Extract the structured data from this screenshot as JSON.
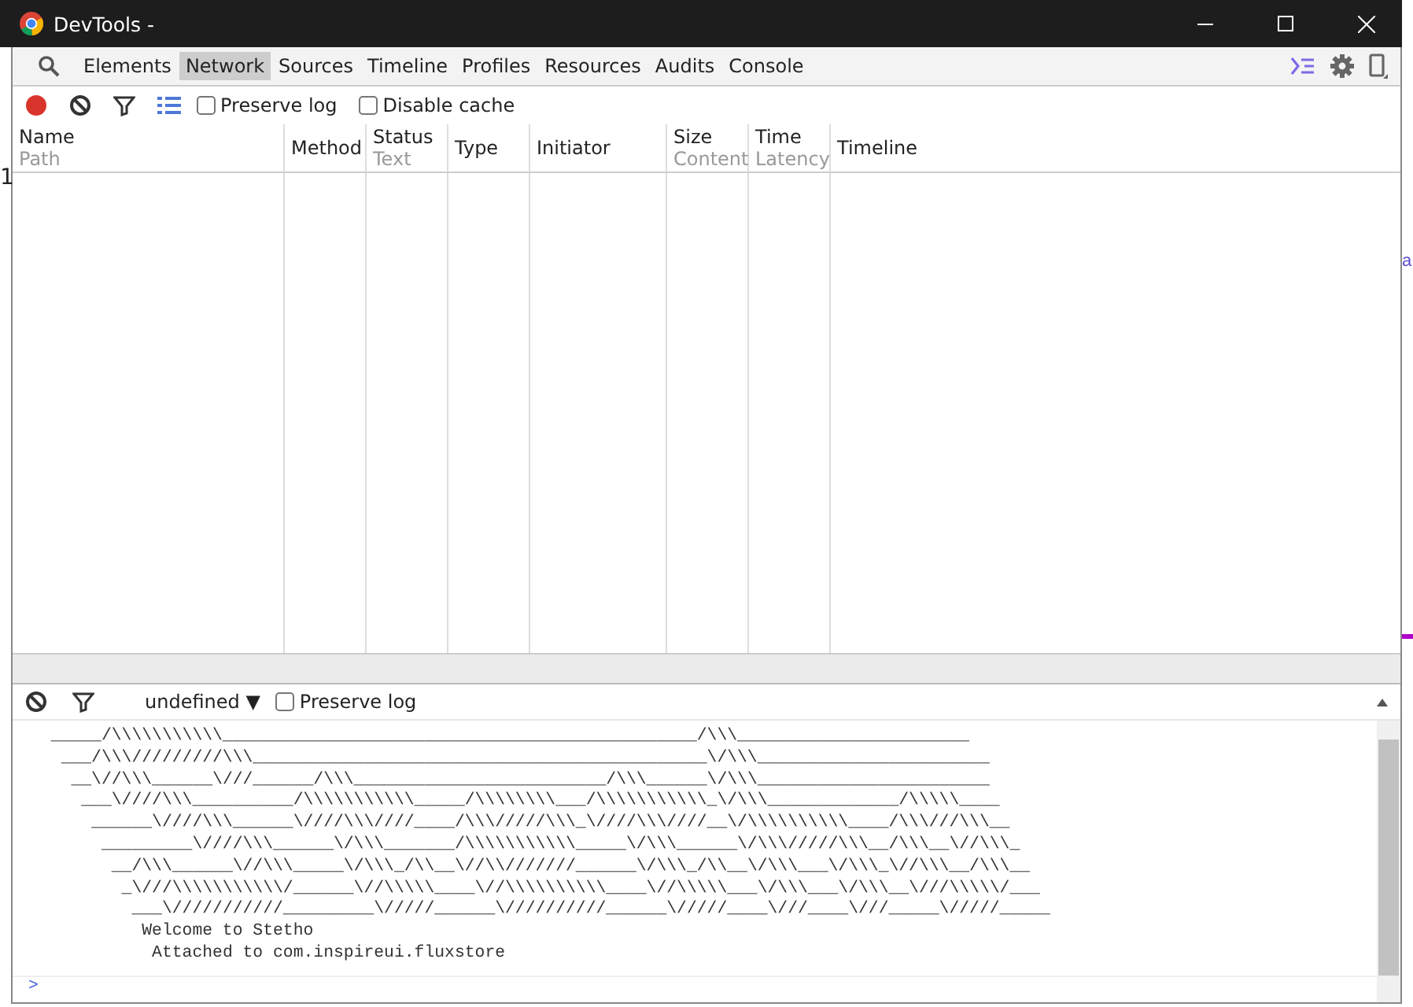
{
  "window": {
    "title": "DevTools -"
  },
  "background_text": [
    "1",
    "a"
  ],
  "tabs": [
    {
      "label": "Elements",
      "selected": false
    },
    {
      "label": "Network",
      "selected": true
    },
    {
      "label": "Sources",
      "selected": false
    },
    {
      "label": "Timeline",
      "selected": false
    },
    {
      "label": "Profiles",
      "selected": false
    },
    {
      "label": "Resources",
      "selected": false
    },
    {
      "label": "Audits",
      "selected": false
    },
    {
      "label": "Console",
      "selected": false
    }
  ],
  "network_toolbar": {
    "recording": true,
    "preserve_log": {
      "label": "Preserve log",
      "checked": false
    },
    "disable_cache": {
      "label": "Disable cache",
      "checked": false
    }
  },
  "columns": [
    {
      "label": "Name",
      "sublabel": "Path"
    },
    {
      "label": "Method"
    },
    {
      "label": "Status",
      "sublabel": "Text"
    },
    {
      "label": "Type"
    },
    {
      "label": "Initiator"
    },
    {
      "label": "Size",
      "sublabel": "Content"
    },
    {
      "label": "Time",
      "sublabel": "Latency"
    },
    {
      "label": "Timeline"
    }
  ],
  "console": {
    "filter": "undefined",
    "dropdown_arrow": "▼",
    "preserve_log": {
      "label": "Preserve log",
      "checked": false
    },
    "lines": [
      "_____/\\\\\\\\\\\\\\\\\\\\\\_______________________________________________/\\\\\\_______________________",
      "___/\\\\\\/////////\\\\\\_____________________________________________\\/\\\\\\_______________________",
      "__\\//\\\\\\______\\///______/\\\\\\_________________________/\\\\\\______\\/\\\\\\_______________________",
      "___\\////\\\\\\__________/\\\\\\\\\\\\\\\\\\\\\\_____/\\\\\\\\\\\\\\\\___/\\\\\\\\\\\\\\\\\\\\\\_\\/\\\\\\_____________/\\\\\\\\\\____",
      "______\\////\\\\\\______\\////\\\\\\////____/\\\\\\/////\\\\\\_\\////\\\\\\////__\\/\\\\\\\\\\\\\\\\\\\\____/\\\\\\///\\\\\\__",
      "_________\\////\\\\\\______\\/\\\\\\_______/\\\\\\\\\\\\\\\\\\\\\\_____\\/\\\\\\______\\/\\\\\\/////\\\\\\__/\\\\\\__\\//\\\\\\_",
      "__/\\\\\\______\\//\\\\\\_____\\/\\\\\\_/\\\\__\\//\\\\///////______\\/\\\\\\_/\\\\__\\/\\\\\\___\\/\\\\\\_\\//\\\\\\__/\\\\\\__",
      "_\\///\\\\\\\\\\\\\\\\\\\\\\/______\\//\\\\\\\\\\____\\//\\\\\\\\\\\\\\\\\\\\____\\//\\\\\\\\\\___\\/\\\\\\___\\/\\\\\\__\\///\\\\\\\\\\/___",
      "___\\///////////_________\\/////______\\//////////______\\/////____\\///____\\///_____\\/////_____",
      "Welcome to Stetho",
      "Attached to com.inspireui.fluxstore"
    ],
    "prompt": ">"
  }
}
